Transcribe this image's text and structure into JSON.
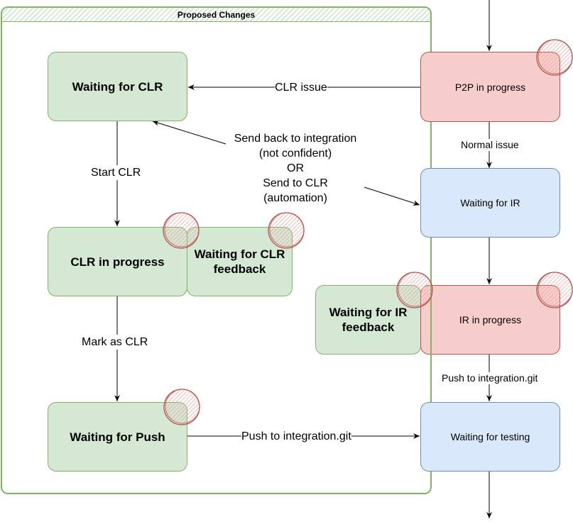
{
  "container": {
    "title": "Proposed Changes"
  },
  "nodes": {
    "waiting_for_clr": "Waiting for CLR",
    "clr_in_progress": "CLR in progress",
    "waiting_for_clr_feedback": "Waiting for CLR feedback",
    "waiting_for_push": "Waiting for Push",
    "p2p_in_progress": "P2P in progress",
    "waiting_for_ir": "Waiting for IR",
    "waiting_for_ir_feedback": "Waiting for IR feedback",
    "ir_in_progress": "IR in progress",
    "waiting_for_testing": "Waiting for testing"
  },
  "edges": {
    "clr_issue": "CLR issue",
    "start_clr": "Start CLR",
    "mark_as_clr": "Mark as CLR",
    "push_to_integration_left": "Push to integration.git",
    "normal_issue": "Normal issue",
    "push_to_integration_right": "Push to integration.git",
    "send_back": [
      "Send back to integration",
      "(not confident)",
      "OR",
      "Send to CLR",
      "(automation)"
    ]
  },
  "colors": {
    "green_fill": "#d5e8d4",
    "green_stroke": "#82b366",
    "red_fill": "#f8cecc",
    "red_stroke": "#b85450",
    "blue_fill": "#dae8fc",
    "blue_stroke": "#6c8ebf",
    "marker_stroke": "#b85450"
  }
}
